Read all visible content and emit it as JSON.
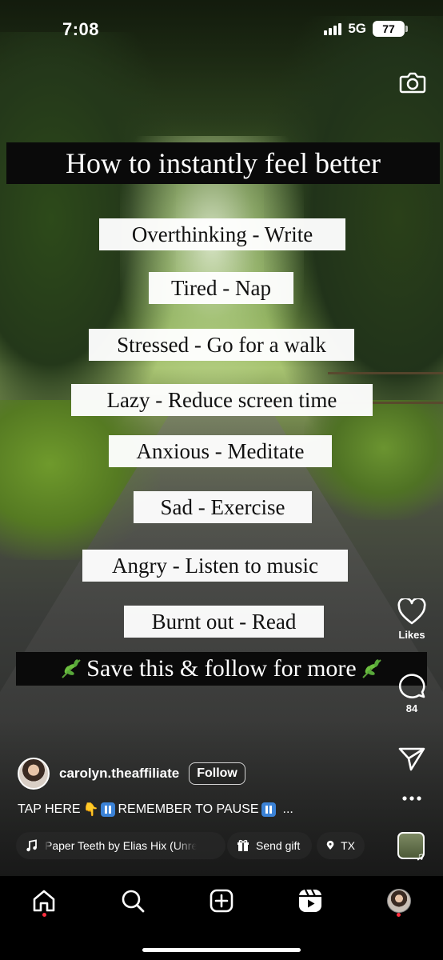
{
  "status_bar": {
    "time": "7:08",
    "network": "5G",
    "battery": "77"
  },
  "overlay": {
    "title": "How to instantly feel better",
    "items": [
      "Overthinking - Write",
      "Tired - Nap",
      "Stressed - Go for a walk",
      "Lazy - Reduce screen time",
      "Anxious - Meditate",
      "Sad - Exercise",
      "Angry - Listen to music",
      "Burnt out - Read"
    ],
    "cta": "Save this & follow for more"
  },
  "actions": {
    "likes_label": "Likes",
    "comments_count": "84"
  },
  "author": {
    "username": "carolyn.theaffiliate",
    "follow_label": "Follow"
  },
  "caption": {
    "part1": "TAP HERE",
    "part2": "REMEMBER TO PAUSE",
    "more": "..."
  },
  "pills": {
    "audio": "Paper Teeth by Elias Hix (Unreleased)",
    "gift": "Send gift",
    "location": "TX"
  },
  "icons": {
    "camera": "camera-icon",
    "like": "heart-icon",
    "comment": "comment-icon",
    "share": "send-icon",
    "more": "more-icon",
    "home": "home-icon",
    "search": "search-icon",
    "create": "plus-square-icon",
    "reels": "reels-icon",
    "profile": "profile-avatar"
  },
  "colors": {
    "notification_dot": "#ff3040",
    "overlay_band": "#0a0a0a",
    "card_bg": "#ffffff"
  }
}
